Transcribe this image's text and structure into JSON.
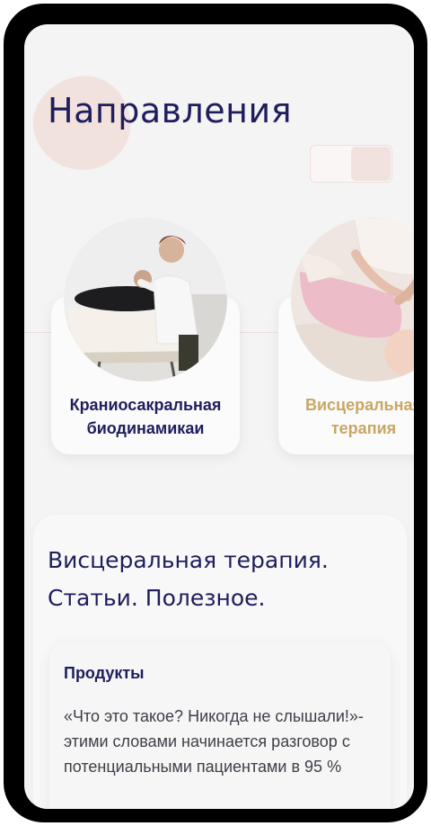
{
  "header": {
    "title": "Направления"
  },
  "directions": [
    {
      "title_line1": "Краниосакральная",
      "title_line2": "биодинамикаи"
    },
    {
      "title_line1": "Висцеральная",
      "title_line2": "терапия"
    }
  ],
  "articles_section": {
    "title_line1": "Висцеральная терапия.",
    "title_line2": "Статьи. Полезное.",
    "card": {
      "category": "Продукты",
      "excerpt": "«Что это такое? Никогда не слышали!»- этими словами начинается разговор с потенциальными пациентами в 95 %"
    }
  },
  "colors": {
    "navy": "#1f1d5c",
    "gold": "#c9a763",
    "blob": "#f2e2dd"
  }
}
